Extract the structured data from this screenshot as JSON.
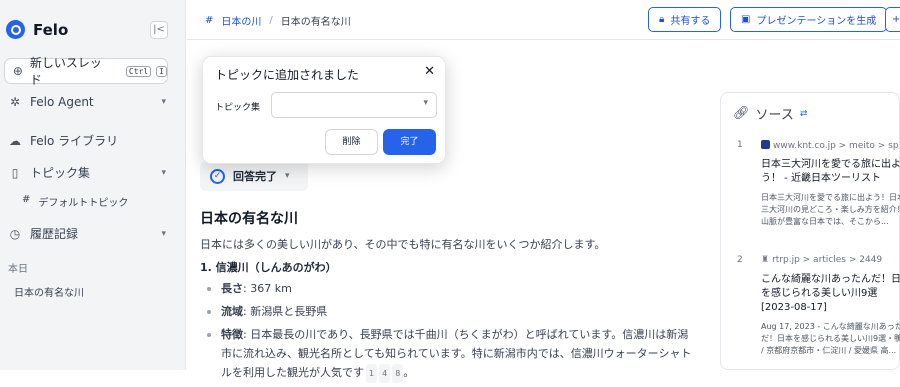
{
  "sidebar": {
    "logo": "Felo",
    "new_thread": "新しいスレッド",
    "shortcut_keys": [
      "Ctrl",
      "I"
    ],
    "nav": [
      {
        "label": "Felo Agent",
        "icon": "agent-icon",
        "chevron": true
      },
      {
        "label": "Felo ライブラリ",
        "icon": "cloud-upload-icon",
        "chevron": false
      },
      {
        "label": "トピック集",
        "icon": "bookmark-icon",
        "chevron": true
      },
      {
        "label": "履歴記録",
        "icon": "history-icon",
        "chevron": true
      }
    ],
    "sub_item": "デフォルトトピック",
    "section_label": "本日",
    "history": [
      "日本の有名な川"
    ]
  },
  "header": {
    "breadcrumb": [
      "日本の川",
      "日本の有名な川"
    ],
    "share_label": "共有する",
    "presentation_label": "プレゼンテーションを生成"
  },
  "popup": {
    "title": "トピックに追加されました",
    "label": "トピック集",
    "select_value": "",
    "delete_label": "削除",
    "done_label": "完了"
  },
  "answer": {
    "status": "回答完了",
    "heading": "日本の有名な川",
    "intro": "日本には多くの美しい川があり、その中でも特に有名な川をいくつか紹介します。",
    "item_title": "1. 信濃川（しんあのがわ）",
    "facts": [
      {
        "key": "長さ",
        "value": ": 367 km"
      },
      {
        "key": "流域",
        "value": ": 新潟県と長野県"
      },
      {
        "key": "特徴",
        "value": ": 日本最長の川であり、長野県では千曲川（ちくまがわ）と呼ばれています。信濃川は新潟市に流れ込み、観光名所としても知られています。特に新潟市内では、信濃川ウォーターシャトルを利用した観光が人気です",
        "cites": [
          "1",
          "4",
          "8"
        ]
      }
    ]
  },
  "sources": {
    "title": "ソース",
    "items": [
      {
        "num": "1",
        "url": "www.knt.co.jp > meito > sp",
        "title": "日本三大河川を愛でる旅に出よう！ - 近畿日本ツーリスト",
        "desc": "日本三大河川を愛でる旅に出よう！日本三大河川の見どころ・楽しみ方を紹介！山脈が豊富な日本では、そこから..."
      },
      {
        "num": "2",
        "url": "rtrp.jp > articles > 2449",
        "title": "こんな綺麗な川あったんだ！日本を感じられる美しい川9選 [2023-08-17]",
        "desc": "Aug 17, 2023 - こんな綺麗な川あったんだ！日本を感じられる美しい川9選・鴨川 / 京都府京都市・仁淀川 / 愛媛県 高..."
      }
    ]
  },
  "colors": {
    "accent": "#2563eb",
    "sidebar_bg": "#f3f4f6"
  }
}
